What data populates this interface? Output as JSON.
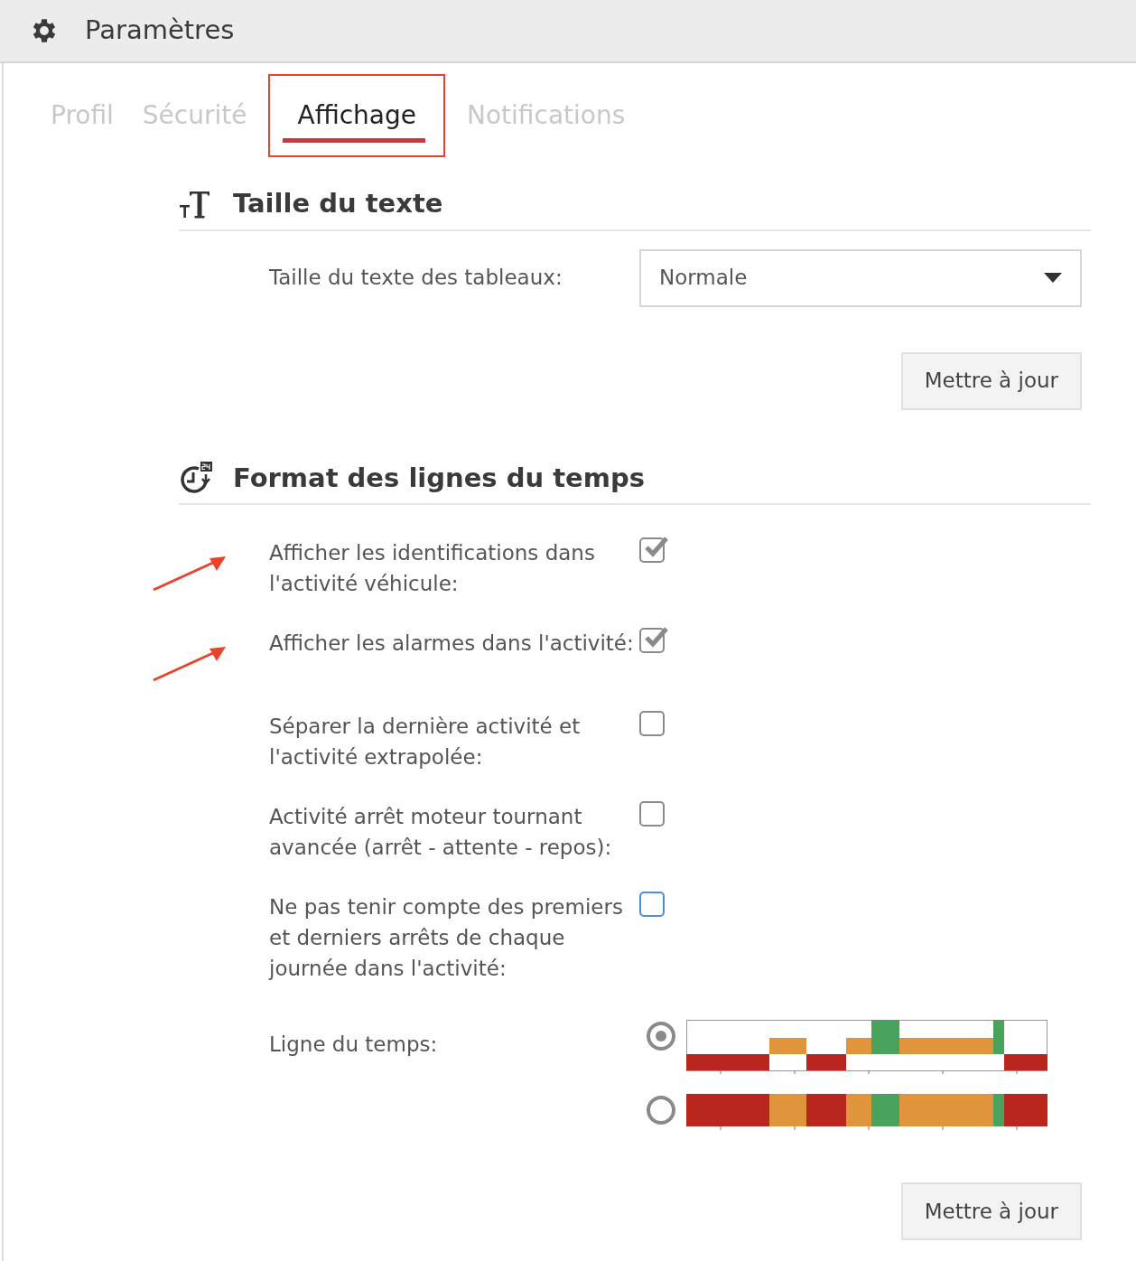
{
  "window": {
    "title": "Paramètres"
  },
  "tabs": [
    {
      "label": "Profil",
      "selected": false
    },
    {
      "label": "Sécurité",
      "selected": false
    },
    {
      "label": "Affichage",
      "selected": true
    },
    {
      "label": "Notifications",
      "selected": false
    }
  ],
  "text_size": {
    "heading": "Taille du texte",
    "label": "Taille du texte des tableaux:",
    "value": "Normale",
    "button": "Mettre à jour"
  },
  "timeline_format": {
    "heading": "Format des lignes du temps",
    "options": [
      {
        "label": "Afficher les identifications dans l'activité véhicule:",
        "checked": true,
        "focused": false,
        "annotated": true
      },
      {
        "label": "Afficher les alarmes dans l'activité:",
        "checked": true,
        "focused": false,
        "annotated": true
      },
      {
        "label": "Séparer la dernière activité et l'activité extrapolée:",
        "checked": false,
        "focused": false,
        "annotated": false
      },
      {
        "label": "Activité arrêt moteur tournant avancée (arrêt - attente - repos):",
        "checked": false,
        "focused": false,
        "annotated": false
      },
      {
        "label": "Ne pas tenir compte des premiers et derniers arrêts de chaque journée dans l'activité:",
        "checked": false,
        "focused": true,
        "annotated": false
      }
    ],
    "timeline_label": "Ligne du temps:",
    "timeline_styles": [
      {
        "kind": "stepped",
        "selected": true
      },
      {
        "kind": "flat",
        "selected": false
      }
    ],
    "button": "Mettre à jour"
  }
}
